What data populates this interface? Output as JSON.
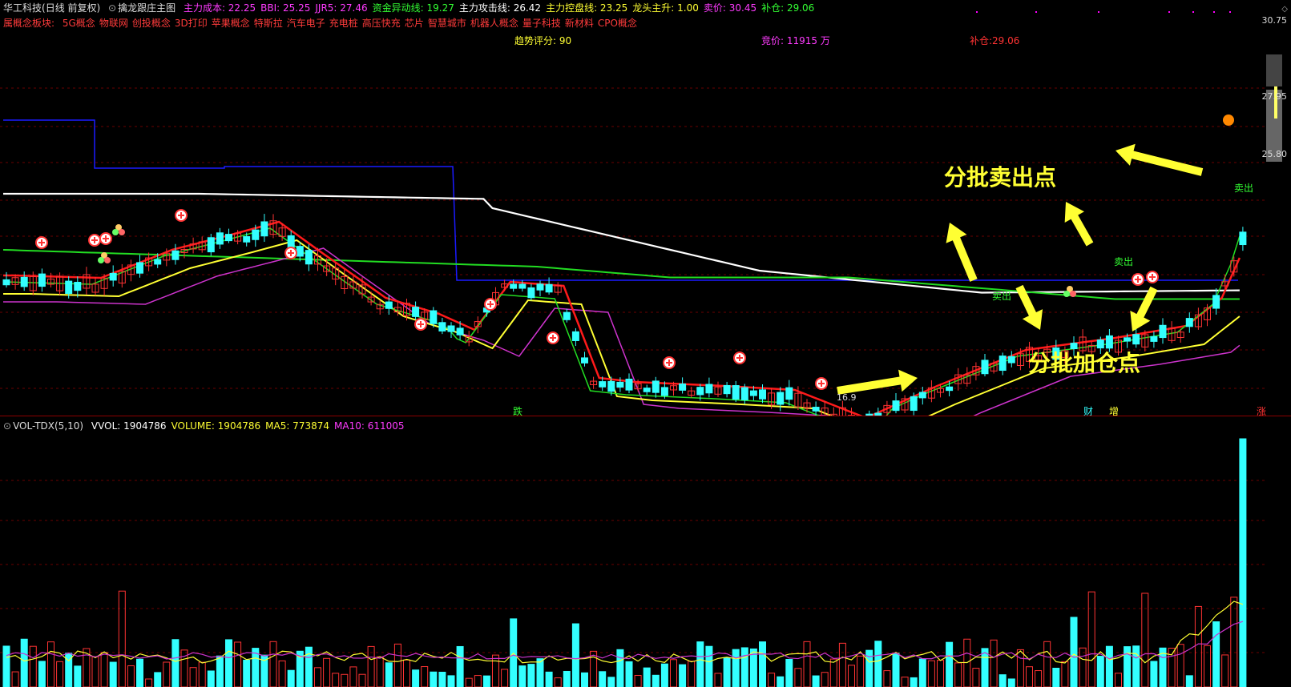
{
  "header": {
    "stock": "华工科技",
    "period": "(日线 前复权)",
    "indicator": "擒龙跟庄主图",
    "items": [
      {
        "label": "主力成本: 22.25",
        "color": "#ff3bff"
      },
      {
        "label": "BBI: 25.25",
        "color": "#ff3bff"
      },
      {
        "label": "JJR5: 27.46",
        "color": "#ff3bff"
      },
      {
        "label": "资金异动线: 19.27",
        "color": "#33ff33"
      },
      {
        "label": "主力攻击线: 26.42",
        "color": "#ffffff"
      },
      {
        "label": "主力控盘线: 23.25",
        "color": "#ffff33"
      },
      {
        "label": "龙头主升: 1.00",
        "color": "#ffff33"
      },
      {
        "label": "卖价: 30.45",
        "color": "#ff3bff"
      },
      {
        "label": "补仓: 29.06",
        "color": "#33ff33"
      }
    ]
  },
  "concepts": {
    "label": "属概念板块:",
    "items": [
      "5G概念",
      "物联网",
      "创投概念",
      "3D打印",
      "苹果概念",
      "特斯拉",
      "汽车电子",
      "充电桩",
      "高压快充",
      "芯片",
      "智慧城市",
      "机器人概念",
      "量子科技",
      "新材料",
      "CPO概念"
    ]
  },
  "stats": {
    "trend_label": "趋势评分: 90",
    "bid_label": "竞价: 11915 万",
    "refill_label": "补仓:29.06"
  },
  "price_scale": [
    "30.75",
    "27.95",
    "25.80"
  ],
  "annotations": {
    "sell_points": "分批卖出点",
    "add_points": "分批加仓点"
  },
  "signals": {
    "sell1": "卖出",
    "sell2": "卖出",
    "sell3": "卖出",
    "low_label": "16.9",
    "die": "跌",
    "cai": "财",
    "zeng": "增",
    "zhang": "涨"
  },
  "volume": {
    "indicator": "VOL-TDX(5,10)",
    "items": [
      {
        "label": "VVOL: 1904786",
        "color": "#ffffff"
      },
      {
        "label": "VOLUME: 1904786",
        "color": "#ffff33"
      },
      {
        "label": "MA5: 773874",
        "color": "#ffff33"
      },
      {
        "label": "MA10: 611005",
        "color": "#ff3bff"
      }
    ]
  },
  "colors": {
    "up": "#ff3333",
    "down": "#33ffff",
    "ma_red": "#ff1a1a",
    "ma_yellow": "#ffff33",
    "ma_green": "#22dd22",
    "ma_magenta": "#cc33cc",
    "ma_white": "#ffffff",
    "blue": "#1a1aff",
    "annotation": "#ffff33"
  },
  "chart_data": {
    "type": "candlestick",
    "y_scale_labels": [
      30.75,
      27.95,
      25.8
    ],
    "last_close": 30.45,
    "volume_last": 1904786,
    "ma5_volume": 773874,
    "ma10_volume": 611005
  }
}
